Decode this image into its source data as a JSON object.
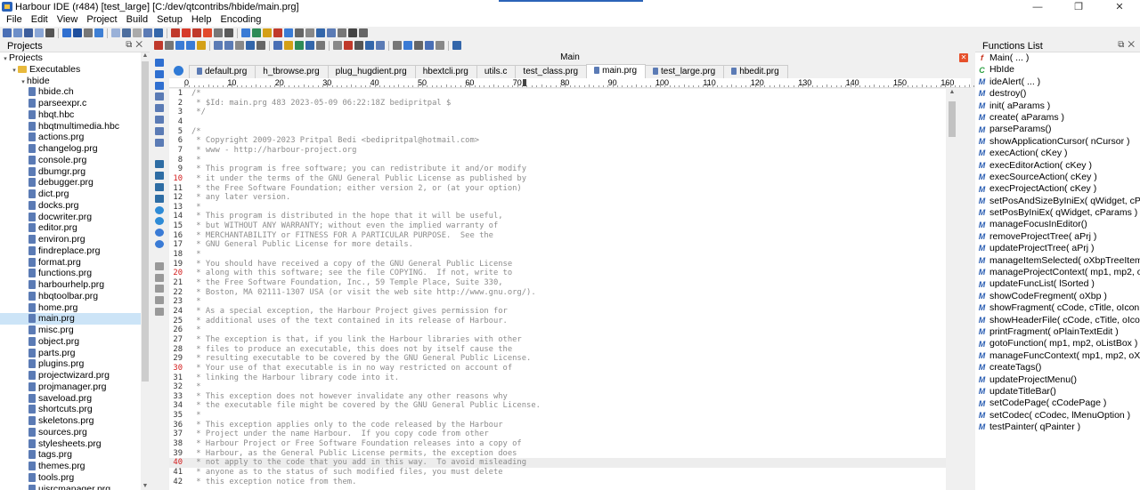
{
  "window": {
    "title": "Harbour IDE (r484) [test_large]  [C:/dev/qtcontribs/hbide/main.prg]",
    "minimize": "—",
    "maximize": "❐",
    "close": "✕"
  },
  "menu": [
    "File",
    "Edit",
    "View",
    "Project",
    "Build",
    "Setup",
    "Help",
    "Encoding"
  ],
  "projects_panel": {
    "title": "Projects",
    "tree": [
      {
        "label": "Projects",
        "level": 0,
        "twisty": "▾",
        "icon": "none"
      },
      {
        "label": "Executables",
        "level": 1,
        "twisty": "▾",
        "icon": "folder"
      },
      {
        "label": "hbide",
        "level": 2,
        "twisty": "▾",
        "icon": "none"
      },
      {
        "label": "hbide.ch",
        "level": 3,
        "icon": "file"
      },
      {
        "label": "parseexpr.c",
        "level": 3,
        "icon": "file"
      },
      {
        "label": "hbqt.hbc",
        "level": 3,
        "icon": "file"
      },
      {
        "label": "hbqtmultimedia.hbc",
        "level": 3,
        "icon": "file"
      },
      {
        "label": "actions.prg",
        "level": 3,
        "icon": "file"
      },
      {
        "label": "changelog.prg",
        "level": 3,
        "icon": "file"
      },
      {
        "label": "console.prg",
        "level": 3,
        "icon": "file"
      },
      {
        "label": "dbumgr.prg",
        "level": 3,
        "icon": "file"
      },
      {
        "label": "debugger.prg",
        "level": 3,
        "icon": "file"
      },
      {
        "label": "dict.prg",
        "level": 3,
        "icon": "file"
      },
      {
        "label": "docks.prg",
        "level": 3,
        "icon": "file"
      },
      {
        "label": "docwriter.prg",
        "level": 3,
        "icon": "file"
      },
      {
        "label": "editor.prg",
        "level": 3,
        "icon": "file"
      },
      {
        "label": "environ.prg",
        "level": 3,
        "icon": "file"
      },
      {
        "label": "findreplace.prg",
        "level": 3,
        "icon": "file"
      },
      {
        "label": "format.prg",
        "level": 3,
        "icon": "file"
      },
      {
        "label": "functions.prg",
        "level": 3,
        "icon": "file"
      },
      {
        "label": "harbourhelp.prg",
        "level": 3,
        "icon": "file"
      },
      {
        "label": "hbqtoolbar.prg",
        "level": 3,
        "icon": "file"
      },
      {
        "label": "home.prg",
        "level": 3,
        "icon": "file"
      },
      {
        "label": "main.prg",
        "level": 3,
        "icon": "file",
        "selected": true
      },
      {
        "label": "misc.prg",
        "level": 3,
        "icon": "file"
      },
      {
        "label": "object.prg",
        "level": 3,
        "icon": "file"
      },
      {
        "label": "parts.prg",
        "level": 3,
        "icon": "file"
      },
      {
        "label": "plugins.prg",
        "level": 3,
        "icon": "file"
      },
      {
        "label": "projectwizard.prg",
        "level": 3,
        "icon": "file"
      },
      {
        "label": "projmanager.prg",
        "level": 3,
        "icon": "file"
      },
      {
        "label": "saveload.prg",
        "level": 3,
        "icon": "file"
      },
      {
        "label": "shortcuts.prg",
        "level": 3,
        "icon": "file"
      },
      {
        "label": "skeletons.prg",
        "level": 3,
        "icon": "file"
      },
      {
        "label": "sources.prg",
        "level": 3,
        "icon": "file"
      },
      {
        "label": "stylesheets.prg",
        "level": 3,
        "icon": "file"
      },
      {
        "label": "tags.prg",
        "level": 3,
        "icon": "file"
      },
      {
        "label": "themes.prg",
        "level": 3,
        "icon": "file"
      },
      {
        "label": "tools.prg",
        "level": 3,
        "icon": "file"
      },
      {
        "label": "uisrcmanager.prg",
        "level": 3,
        "icon": "file"
      }
    ]
  },
  "editor": {
    "header": "Main",
    "tabs": [
      {
        "label": "default.prg",
        "icon": true
      },
      {
        "label": "h_tbrowse.prg",
        "icon": false
      },
      {
        "label": "plug_hugdient.prg",
        "icon": false
      },
      {
        "label": "hbextcli.prg",
        "icon": false
      },
      {
        "label": "utils.c",
        "icon": false
      },
      {
        "label": "test_class.prg",
        "icon": false
      },
      {
        "label": "main.prg",
        "icon": true,
        "active": true
      },
      {
        "label": "test_large.prg",
        "icon": true
      },
      {
        "label": "hbedit.prg",
        "icon": true
      }
    ],
    "ruler": [
      "0",
      "10",
      "20",
      "30",
      "40",
      "50",
      "60",
      "70",
      "80",
      "90",
      "100",
      "110",
      "120",
      "130",
      "140",
      "150",
      "160"
    ],
    "current_line": 40,
    "lines": [
      {
        "n": "1",
        "t": "/*"
      },
      {
        "n": "2",
        "t": " * $Id: main.prg 483 2023-05-09 06:22:18Z bedipritpal $"
      },
      {
        "n": "3",
        "t": " */"
      },
      {
        "n": "4",
        "t": ""
      },
      {
        "n": "5",
        "t": "/*"
      },
      {
        "n": "6",
        "t": " * Copyright 2009-2023 Pritpal Bedi <bedipritpal@hotmail.com>"
      },
      {
        "n": "7",
        "t": " * www - http://harbour-project.org"
      },
      {
        "n": "8",
        "t": " *"
      },
      {
        "n": "9",
        "t": " * This program is free software; you can redistribute it and/or modify"
      },
      {
        "n": "10",
        "t": " * it under the terms of the GNU General Public License as published by",
        "red": true
      },
      {
        "n": "11",
        "t": " * the Free Software Foundation; either version 2, or (at your option)"
      },
      {
        "n": "12",
        "t": " * any later version."
      },
      {
        "n": "13",
        "t": " *"
      },
      {
        "n": "14",
        "t": " * This program is distributed in the hope that it will be useful,"
      },
      {
        "n": "15",
        "t": " * but WITHOUT ANY WARRANTY; without even the implied warranty of"
      },
      {
        "n": "16",
        "t": " * MERCHANTABILITY or FITNESS FOR A PARTICULAR PURPOSE.  See the"
      },
      {
        "n": "17",
        "t": " * GNU General Public License for more details."
      },
      {
        "n": "18",
        "t": " *"
      },
      {
        "n": "19",
        "t": " * You should have received a copy of the GNU General Public License"
      },
      {
        "n": "20",
        "t": " * along with this software; see the file COPYING.  If not, write to",
        "red": true
      },
      {
        "n": "21",
        "t": " * the Free Software Foundation, Inc., 59 Temple Place, Suite 330,"
      },
      {
        "n": "22",
        "t": " * Boston, MA 02111-1307 USA (or visit the web site http://www.gnu.org/)."
      },
      {
        "n": "23",
        "t": " *"
      },
      {
        "n": "24",
        "t": " * As a special exception, the Harbour Project gives permission for"
      },
      {
        "n": "25",
        "t": " * additional uses of the text contained in its release of Harbour."
      },
      {
        "n": "26",
        "t": " *"
      },
      {
        "n": "27",
        "t": " * The exception is that, if you link the Harbour libraries with other"
      },
      {
        "n": "28",
        "t": " * files to produce an executable, this does not by itself cause the"
      },
      {
        "n": "29",
        "t": " * resulting executable to be covered by the GNU General Public License."
      },
      {
        "n": "30",
        "t": " * Your use of that executable is in no way restricted on account of",
        "red": true
      },
      {
        "n": "31",
        "t": " * linking the Harbour library code into it."
      },
      {
        "n": "32",
        "t": " *"
      },
      {
        "n": "33",
        "t": " * This exception does not however invalidate any other reasons why"
      },
      {
        "n": "34",
        "t": " * the executable file might be covered by the GNU General Public License."
      },
      {
        "n": "35",
        "t": " *"
      },
      {
        "n": "36",
        "t": " * This exception applies only to the code released by the Harbour"
      },
      {
        "n": "37",
        "t": " * Project under the name Harbour.  If you copy code from other"
      },
      {
        "n": "38",
        "t": " * Harbour Project or Free Software Foundation releases into a copy of"
      },
      {
        "n": "39",
        "t": " * Harbour, as the General Public License permits, the exception does"
      },
      {
        "n": "40",
        "t": " * not apply to the code that you add in this way.  To avoid misleading",
        "red": true
      },
      {
        "n": "41",
        "t": " * anyone as to the status of such modified files, you must delete"
      },
      {
        "n": "42",
        "t": " * this exception notice from them."
      }
    ]
  },
  "functions_panel": {
    "title": "Functions List",
    "items": [
      {
        "label": "Main( ... )",
        "kind": "red"
      },
      {
        "label": "HbIde",
        "kind": "green"
      },
      {
        "label": "ideAlert( ... )",
        "kind": "blue"
      },
      {
        "label": "destroy()",
        "kind": "blue"
      },
      {
        "label": "init( aParams )",
        "kind": "blue"
      },
      {
        "label": "create( aParams )",
        "kind": "blue"
      },
      {
        "label": "parseParams()",
        "kind": "blue"
      },
      {
        "label": "showApplicationCursor( nCursor )",
        "kind": "blue"
      },
      {
        "label": "execAction( cKey )",
        "kind": "blue"
      },
      {
        "label": "execEditorAction( cKey )",
        "kind": "blue"
      },
      {
        "label": "execSourceAction( cKey )",
        "kind": "blue"
      },
      {
        "label": "execProjectAction( cKey )",
        "kind": "blue"
      },
      {
        "label": "setPosAndSizeByIniEx( qWidget, cParams )",
        "kind": "blue"
      },
      {
        "label": "setPosByIniEx( qWidget, cParams )",
        "kind": "blue"
      },
      {
        "label": "manageFocusInEditor()",
        "kind": "blue"
      },
      {
        "label": "removeProjectTree( aPrj )",
        "kind": "blue"
      },
      {
        "label": "updateProjectTree( aPrj )",
        "kind": "blue"
      },
      {
        "label": "manageItemSelected( oXbpTreeItem )",
        "kind": "blue"
      },
      {
        "label": "manageProjectContext( mp1, mp2, oXbpTree...",
        "kind": "blue"
      },
      {
        "label": "updateFuncList( lSorted )",
        "kind": "blue"
      },
      {
        "label": "showCodeFregment( oXbp )",
        "kind": "blue"
      },
      {
        "label": "showFragment( cCode, cTitle, oIcon, cTheme...",
        "kind": "blue"
      },
      {
        "label": "showHeaderFile( cCode, cTitle, oIcon, lSave )",
        "kind": "blue"
      },
      {
        "label": "printFragment( oPlainTextEdit )",
        "kind": "blue"
      },
      {
        "label": "gotoFunction( mp1, mp2, oListBox )",
        "kind": "blue"
      },
      {
        "label": "manageFuncContext( mp1, mp2, oXbp )",
        "kind": "blue"
      },
      {
        "label": "createTags()",
        "kind": "blue"
      },
      {
        "label": "updateProjectMenu()",
        "kind": "blue"
      },
      {
        "label": "updateTitleBar()",
        "kind": "blue"
      },
      {
        "label": "setCodePage( cCodePage )",
        "kind": "blue"
      },
      {
        "label": "setCodec( cCodec, lMenuOption )",
        "kind": "blue"
      },
      {
        "label": "testPainter( qPainter )",
        "kind": "blue"
      }
    ]
  }
}
